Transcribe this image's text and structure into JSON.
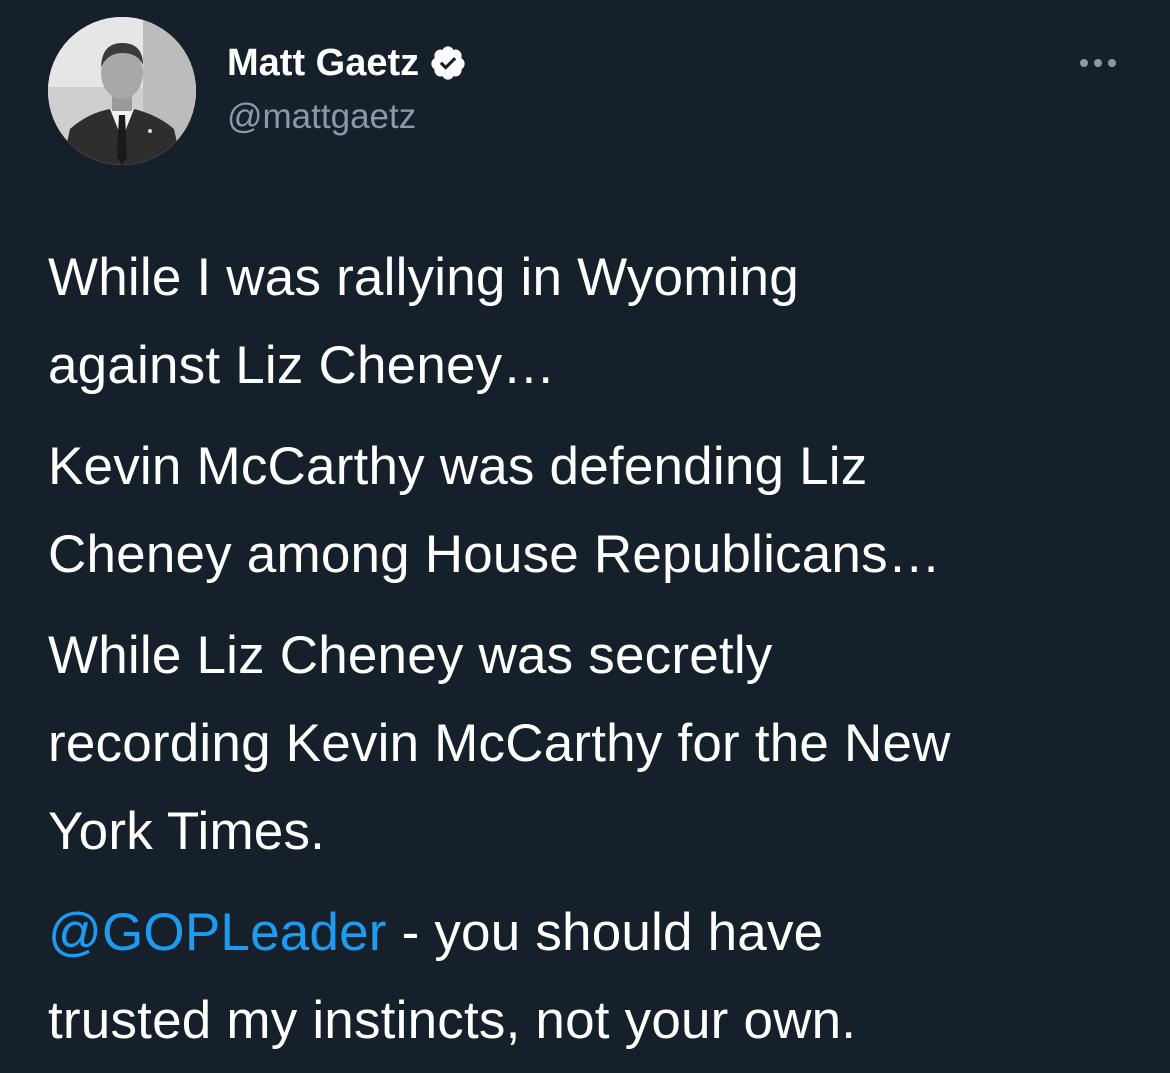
{
  "author": {
    "display_name": "Matt Gaetz",
    "handle": "@mattgaetz",
    "verified": true,
    "verified_icon": "verified-badge-icon",
    "avatar_icon": "profile-photo"
  },
  "more_icon": "more-options-icon",
  "tweet": {
    "paragraphs": [
      [
        "While I was rallying in Wyoming",
        "against Liz Cheney…"
      ],
      [
        "Kevin McCarthy was defending Liz",
        "Cheney among House Republicans…"
      ],
      [
        "While Liz Cheney was secretly",
        "recording Kevin McCarthy for the New",
        "York Times."
      ]
    ],
    "last_paragraph": {
      "mention": "@GOPLeader",
      "line1_rest": " - you should have",
      "line2": "trusted my instincts, not your own."
    }
  },
  "colors": {
    "background": "#15202b",
    "text": "#ffffff",
    "secondary": "#8b98a5",
    "link": "#1d9bf0"
  }
}
